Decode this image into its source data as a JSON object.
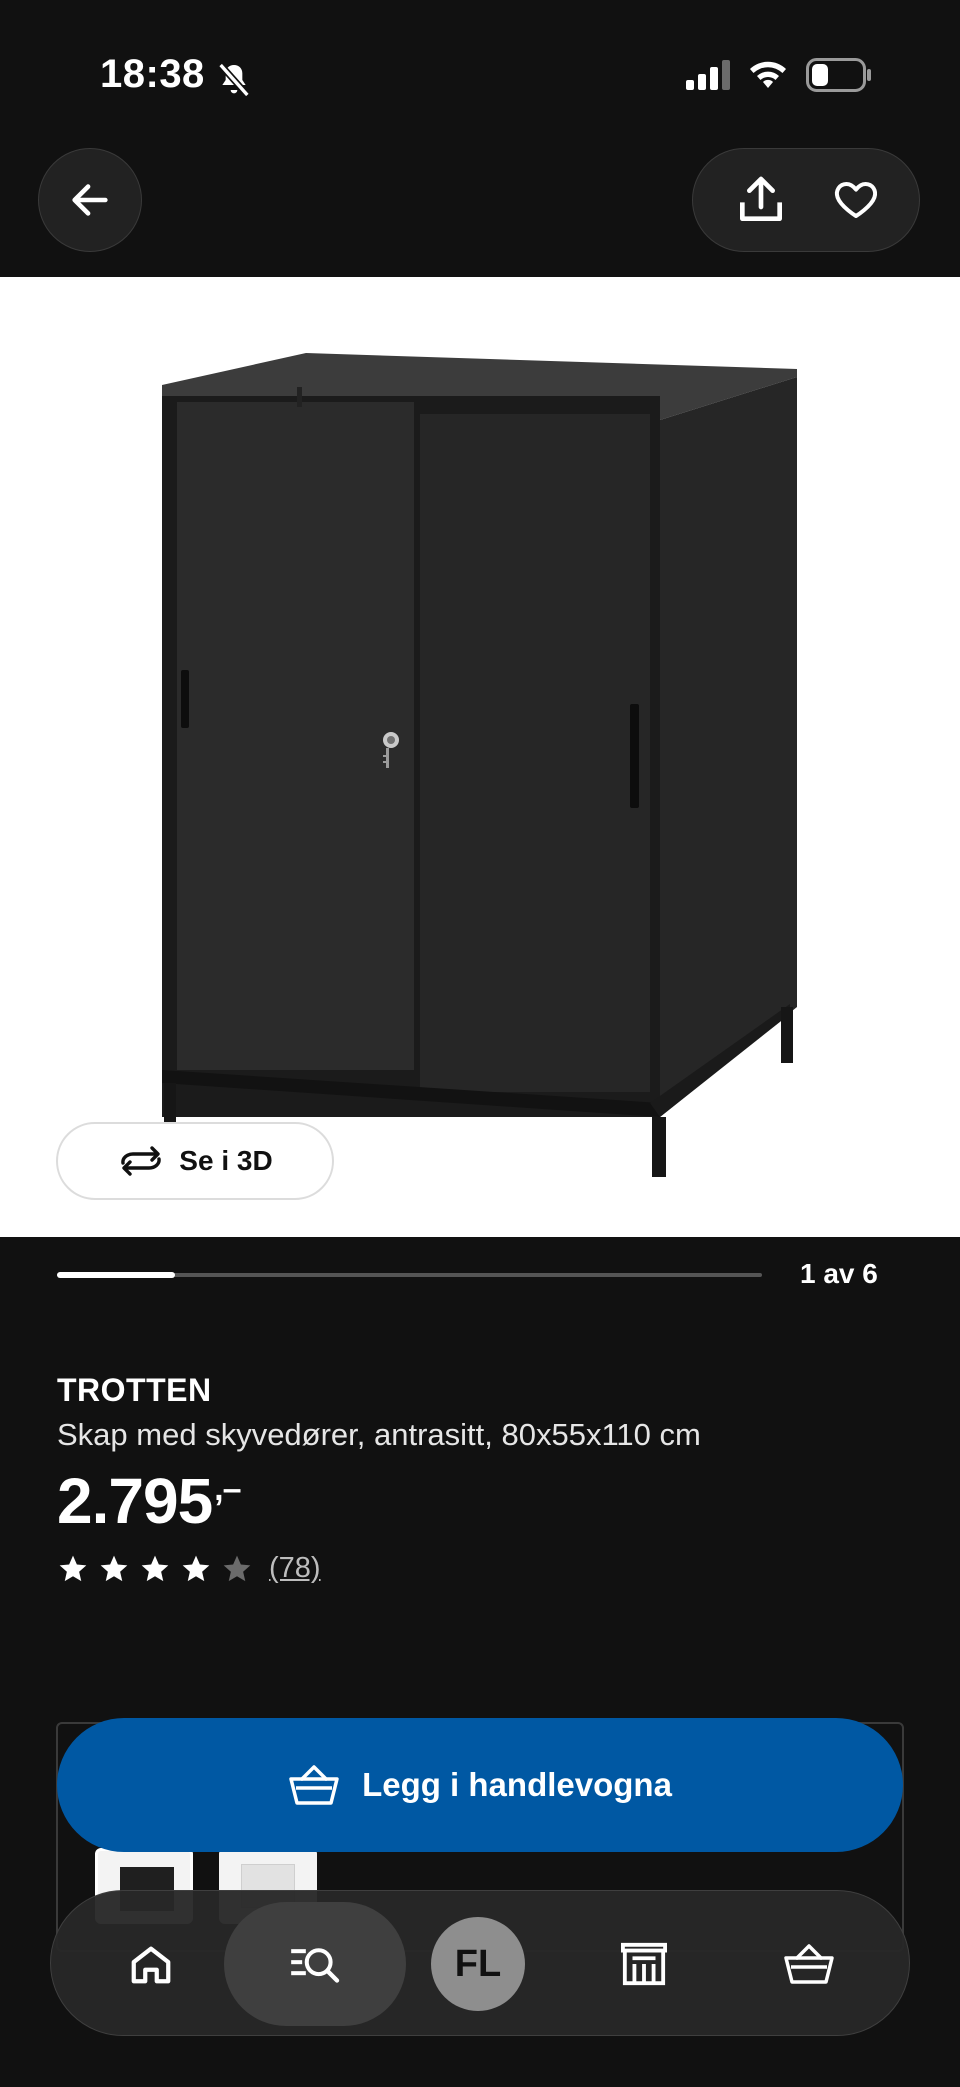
{
  "status_bar": {
    "time": "18:38"
  },
  "product": {
    "brand": "TROTTEN",
    "description": "Skap med skyvedører, antrasitt, 80x55x110 cm",
    "price": "2.795",
    "price_suffix": ",–",
    "rating_value": 4,
    "rating_max": 5,
    "review_count": "(78)"
  },
  "gallery": {
    "view_3d_label": "Se i 3D",
    "pager": "1 av 6",
    "progress_fraction": 0.167
  },
  "actions": {
    "add_to_cart_label": "Legg i handlevogna"
  },
  "tab_bar": {
    "profile_initials": "FL"
  },
  "colors": {
    "background": "#111111",
    "primary_blue": "#0058a3",
    "star": "#ffffff",
    "star_empty": "#6b6b6b"
  }
}
